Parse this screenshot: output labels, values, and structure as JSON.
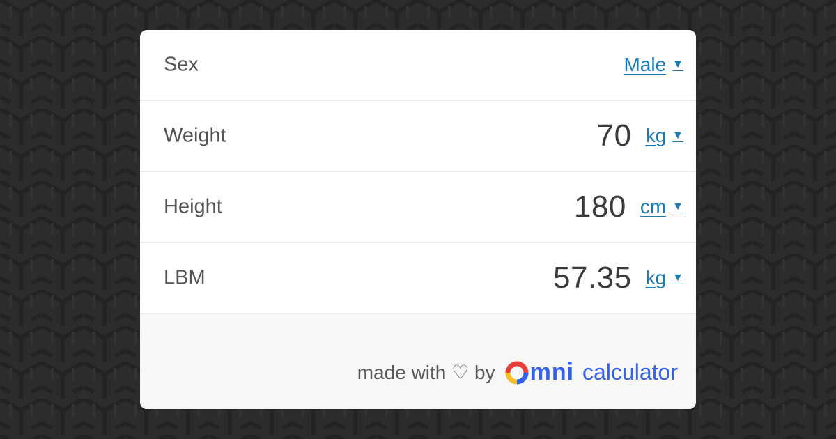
{
  "rows": [
    {
      "label": "Sex",
      "value": "",
      "unit": "Male"
    },
    {
      "label": "Weight",
      "value": "70",
      "unit": "kg"
    },
    {
      "label": "Height",
      "value": "180",
      "unit": "cm"
    },
    {
      "label": "LBM",
      "value": "57.35",
      "unit": "kg"
    }
  ],
  "footer": {
    "made_with": "made with ♡ by",
    "brand_name": "mni",
    "brand_suffix": "calculator"
  },
  "colors": {
    "link": "#1a7bb4",
    "brand": "#3461e6",
    "background": "#2c2c2c"
  },
  "icons": {
    "caret": "caret-down-icon",
    "logo": "omni-logo-icon"
  }
}
